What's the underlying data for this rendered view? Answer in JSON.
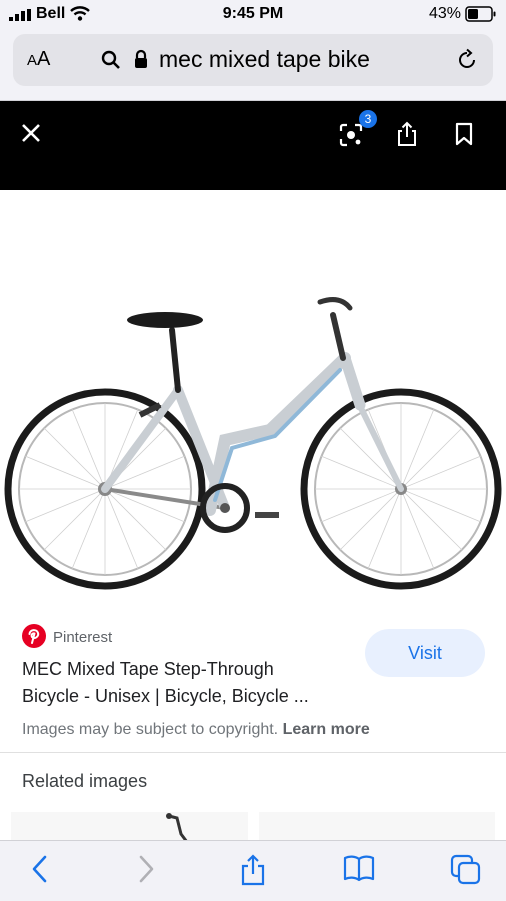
{
  "status_bar": {
    "carrier": "Bell",
    "time": "9:45 PM",
    "battery": "43%"
  },
  "address_bar": {
    "text_size_label_small": "A",
    "text_size_label_large": "A",
    "url_text": "mec mixed tape bike"
  },
  "lens_bar": {
    "badge_count": "3"
  },
  "result": {
    "source": "Pinterest",
    "title_line1": "MEC Mixed Tape Step-Through",
    "title_line2": "Bicycle - Unisex | Bicycle, Bicycle ...",
    "visit_label": "Visit",
    "copyright_text": "Images may be subject to copyright.",
    "learn_more": "Learn more"
  },
  "related": {
    "heading": "Related images"
  },
  "colors": {
    "accent": "#1a73e8",
    "bike_frame": "#c9ced3",
    "bike_accent": "#8fb8d8",
    "pinterest": "#e60023"
  }
}
